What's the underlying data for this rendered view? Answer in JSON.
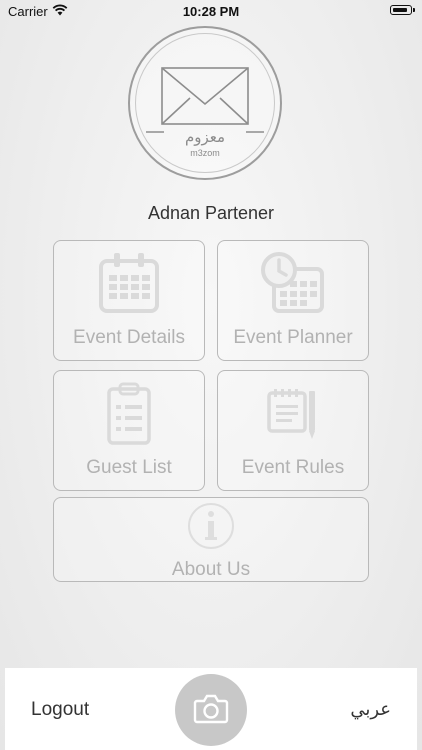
{
  "status_bar": {
    "carrier": "Carrier",
    "time": "10:28 PM"
  },
  "logo": {
    "arabic_text": "معزوم",
    "english_text": "m3zom"
  },
  "user": {
    "name": "Adnan Partener"
  },
  "menu": {
    "event_details": "Event Details",
    "event_planner": "Event Planner",
    "guest_list": "Guest List",
    "event_rules": "Event Rules",
    "about_us": "About Us"
  },
  "bottom_bar": {
    "logout": "Logout",
    "language": "عربي"
  }
}
